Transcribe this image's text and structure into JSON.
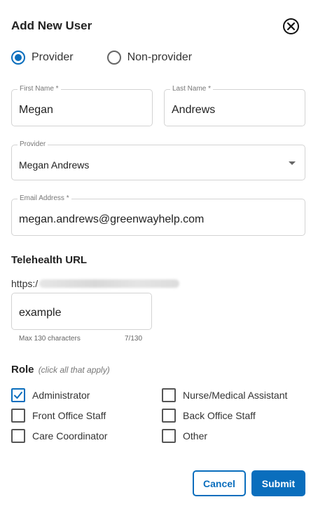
{
  "dialog": {
    "title": "Add New User"
  },
  "user_type": {
    "options": [
      {
        "label": "Provider",
        "selected": true
      },
      {
        "label": "Non-provider",
        "selected": false
      }
    ]
  },
  "fields": {
    "first_name": {
      "label": "First Name *",
      "value": "Megan"
    },
    "last_name": {
      "label": "Last Name *",
      "value": "Andrews"
    },
    "provider": {
      "label": "Provider",
      "value": "Megan Andrews"
    },
    "email": {
      "label": "Email Address *",
      "value": "megan.andrews@greenwayhelp.com"
    }
  },
  "telehealth": {
    "title": "Telehealth URL",
    "prefix": "https:/",
    "value": "example",
    "max_hint": "Max 130 characters",
    "count": "7/130"
  },
  "role": {
    "title": "Role",
    "subtitle": "(click all that apply)",
    "options": [
      {
        "label": "Administrator",
        "checked": true
      },
      {
        "label": "Nurse/Medical Assistant",
        "checked": false
      },
      {
        "label": "Front Office Staff",
        "checked": false
      },
      {
        "label": "Back Office Staff",
        "checked": false
      },
      {
        "label": "Care Coordinator",
        "checked": false
      },
      {
        "label": "Other",
        "checked": false
      }
    ]
  },
  "actions": {
    "cancel_label": "Cancel",
    "submit_label": "Submit"
  },
  "colors": {
    "accent": "#0a6ebd",
    "border": "#d3d3d3"
  }
}
